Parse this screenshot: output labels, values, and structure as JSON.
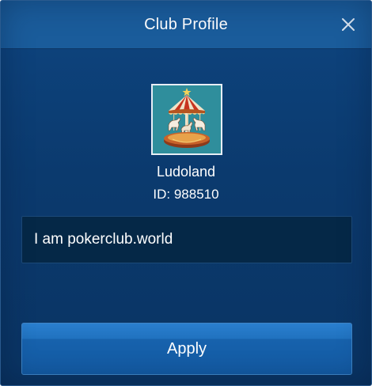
{
  "dialog": {
    "title": "Club Profile",
    "close_icon": "close-icon"
  },
  "club": {
    "avatar_icon": "carousel-avatar-icon",
    "name": "Ludoland",
    "id_text": "ID: 988510",
    "description": "I am pokerclub.world"
  },
  "actions": {
    "apply_label": "Apply"
  },
  "colors": {
    "header": "#1a5c9b",
    "body": "#0b3a6e",
    "field": "#052847",
    "button": "#1d6bb8",
    "avatar_bg": "#2f8e9c"
  }
}
